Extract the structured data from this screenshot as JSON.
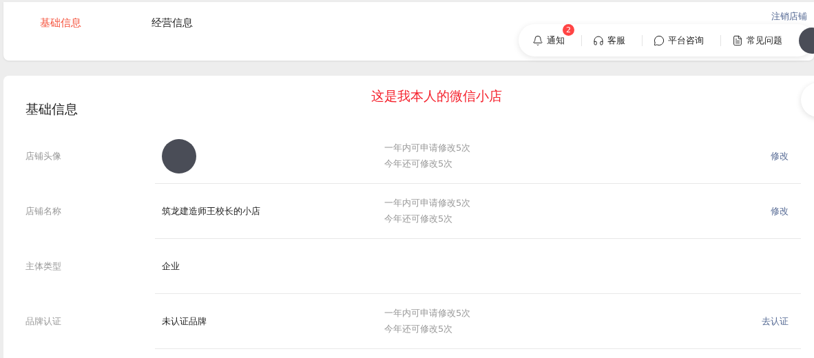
{
  "tabs": [
    {
      "label": "基础信息",
      "selected": true
    },
    {
      "label": "经营信息",
      "selected": false
    }
  ],
  "cancel_store_link": "注销店铺",
  "toolbar": {
    "items": [
      {
        "kind": "bell",
        "label": "通知",
        "badge": "2"
      },
      {
        "kind": "headset",
        "label": "客服"
      },
      {
        "kind": "chat",
        "label": "平台咨询"
      },
      {
        "kind": "doc",
        "label": "常见问题"
      }
    ]
  },
  "annotation": "这是我本人的微信小店",
  "section": {
    "title": "基础信息",
    "rows": [
      {
        "label": "店铺头像",
        "kind": "avatar",
        "hints": [
          "一年内可申请修改5次",
          "今年还可修改5次"
        ],
        "action": "修改"
      },
      {
        "label": "店铺名称",
        "kind": "text",
        "value": "筑龙建造师王校长的小店",
        "hints": [
          "一年内可申请修改5次",
          "今年还可修改5次"
        ],
        "action": "修改"
      },
      {
        "label": "主体类型",
        "kind": "text",
        "value": "企业"
      },
      {
        "label": "品牌认证",
        "kind": "text",
        "value": "未认证品牌",
        "hints": [
          "一年内可申请修改5次",
          "今年还可修改5次"
        ],
        "action": "去认证"
      }
    ]
  }
}
